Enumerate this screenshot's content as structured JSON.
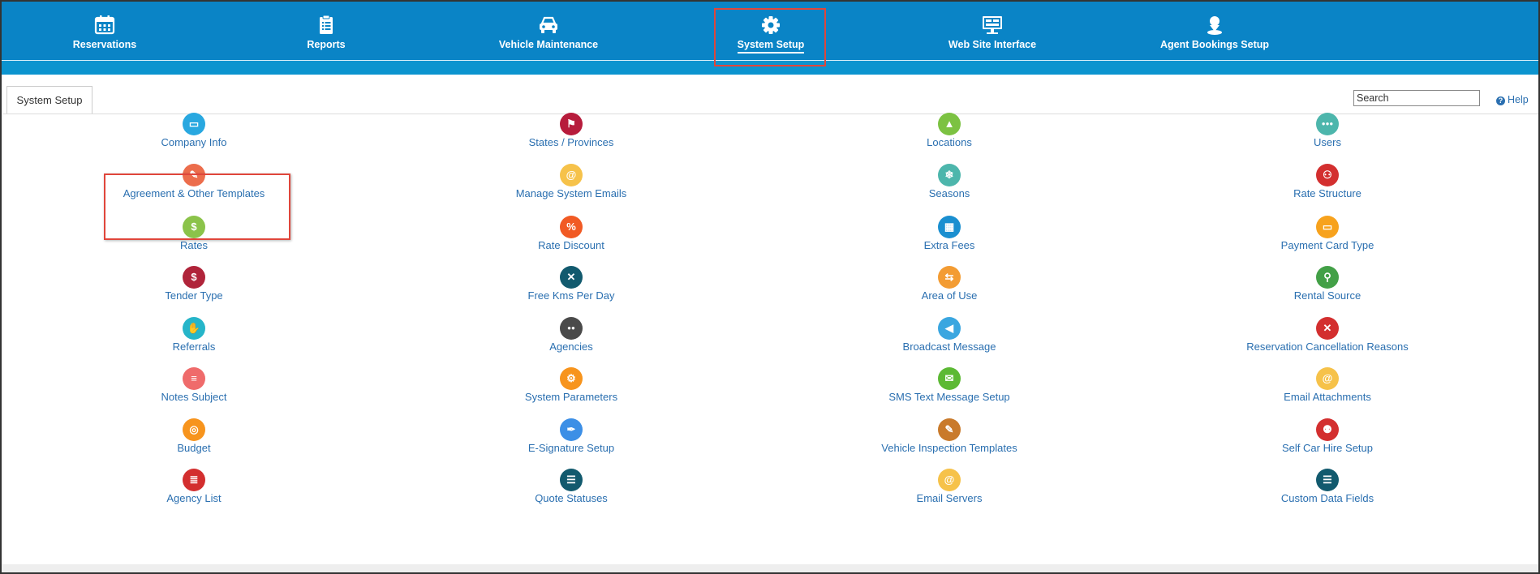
{
  "nav": {
    "items": [
      {
        "label": "Reservations",
        "icon": "calendar-icon"
      },
      {
        "label": "Reports",
        "icon": "clipboard-icon"
      },
      {
        "label": "Vehicle Maintenance",
        "icon": "car-icon"
      },
      {
        "label": "System Setup",
        "icon": "gear-icon"
      },
      {
        "label": "Web Site Interface",
        "icon": "monitor-icon"
      },
      {
        "label": "Agent Bookings Setup",
        "icon": "agent-icon"
      }
    ],
    "active": "System Setup"
  },
  "tab": {
    "label": "System Setup"
  },
  "search": {
    "placeholder": "Search",
    "value": ""
  },
  "help": {
    "label": "Help"
  },
  "colors": {
    "nav_bg": "#0a84c6",
    "link": "#2a6fb0",
    "highlight": "#e0463b"
  },
  "columns": [
    [
      {
        "label": "Company Info",
        "icon": "folder-icon",
        "color": "#29a8e0"
      },
      {
        "label": "Agreement & Other Templates",
        "icon": "edit-icon",
        "color": "#ec6d4c"
      },
      {
        "label": "Rates",
        "icon": "money-icon",
        "color": "#8bc34a"
      },
      {
        "label": "Tender Type",
        "icon": "money-bag-icon",
        "color": "#b0243a"
      },
      {
        "label": "Referrals",
        "icon": "hand-icon",
        "color": "#26b5c9"
      },
      {
        "label": "Notes Subject",
        "icon": "notes-icon",
        "color": "#ef6b6b"
      },
      {
        "label": "Budget",
        "icon": "target-icon",
        "color": "#f7941d"
      },
      {
        "label": "Agency List",
        "icon": "list-icon",
        "color": "#d32f2f"
      }
    ],
    [
      {
        "label": "States / Provinces",
        "icon": "flag-icon",
        "color": "#b71c3c"
      },
      {
        "label": "Manage System Emails",
        "icon": "at-icon",
        "color": "#f6c24a"
      },
      {
        "label": "Rate Discount",
        "icon": "percent-icon",
        "color": "#f15a24"
      },
      {
        "label": "Free Kms Per Day",
        "icon": "road-icon",
        "color": "#125a6e"
      },
      {
        "label": "Agencies",
        "icon": "people-icon",
        "color": "#4a4a4a"
      },
      {
        "label": "System Parameters",
        "icon": "gears-icon",
        "color": "#f7941d"
      },
      {
        "label": "E-Signature Setup",
        "icon": "pen-icon",
        "color": "#3c8fe6"
      },
      {
        "label": "Quote Statuses",
        "icon": "checklist-icon",
        "color": "#125a6e"
      }
    ],
    [
      {
        "label": "Locations",
        "icon": "map-icon",
        "color": "#7cc242"
      },
      {
        "label": "Seasons",
        "icon": "snowflake-icon",
        "color": "#4db6ac"
      },
      {
        "label": "Extra Fees",
        "icon": "grid-icon",
        "color": "#1a8fd0"
      },
      {
        "label": "Area of Use",
        "icon": "signpost-icon",
        "color": "#f39c33"
      },
      {
        "label": "Broadcast Message",
        "icon": "megaphone-icon",
        "color": "#3aa6e0"
      },
      {
        "label": "SMS Text Message Setup",
        "icon": "sms-icon",
        "color": "#5cb934"
      },
      {
        "label": "Vehicle Inspection Templates",
        "icon": "inspection-icon",
        "color": "#c97a2b"
      },
      {
        "label": "Email Servers",
        "icon": "at-icon",
        "color": "#f6c24a"
      }
    ],
    [
      {
        "label": "Users",
        "icon": "users-icon",
        "color": "#4db6ac"
      },
      {
        "label": "Rate Structure",
        "icon": "structure-icon",
        "color": "#d32f2f"
      },
      {
        "label": "Payment Card Type",
        "icon": "card-icon",
        "color": "#f7a21d"
      },
      {
        "label": "Rental Source",
        "icon": "magnifier-icon",
        "color": "#43a047"
      },
      {
        "label": "Reservation Cancellation Reasons",
        "icon": "cancel-icon",
        "color": "#d32f2f"
      },
      {
        "label": "Email Attachments",
        "icon": "at-icon",
        "color": "#f6c24a"
      },
      {
        "label": "Self Car Hire Setup",
        "icon": "self-hire-icon",
        "color": "#d32f2f"
      },
      {
        "label": "Custom Data Fields",
        "icon": "checklist-icon",
        "color": "#125a6e"
      }
    ]
  ]
}
